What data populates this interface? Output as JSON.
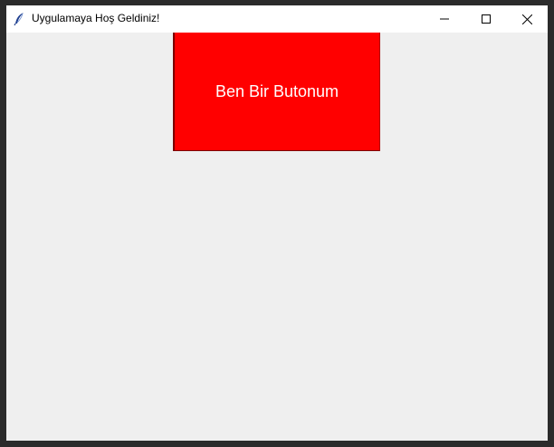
{
  "window": {
    "title": "Uygulamaya Hoş Geldiniz!",
    "icon": "feather-icon",
    "controls": {
      "minimize_icon": "minimize-icon",
      "maximize_icon": "maximize-icon",
      "close_icon": "close-icon"
    }
  },
  "main": {
    "button_label": "Ben Bir Butonum",
    "button_color": "#ff0000",
    "button_text_color": "#ffffff",
    "background_color": "#efefef"
  }
}
